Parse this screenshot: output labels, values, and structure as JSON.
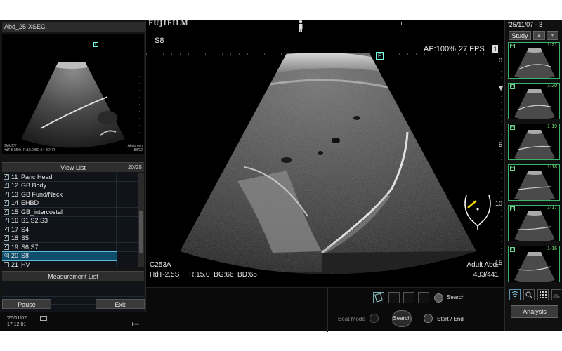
{
  "left_panel": {
    "title": "Abd_25-XSEC.",
    "thumb_meta_left": "BMk/CV\nHdT-5 MHz  R:18.0 BG:54 BD:77",
    "thumb_meta_right": "Abdomen\n88/92",
    "thumb_badge": "F",
    "view_list": {
      "title": "View List",
      "count": "20/25",
      "items": [
        {
          "check": "✓",
          "num": "11",
          "label": "Panc Head"
        },
        {
          "check": "✓",
          "num": "12",
          "label": "GB Body"
        },
        {
          "check": "✓",
          "num": "13",
          "label": "GB Fund/Neck"
        },
        {
          "check": "✓",
          "num": "14",
          "label": "EHBD"
        },
        {
          "check": "✓",
          "num": "15",
          "label": "GB_intercostal"
        },
        {
          "check": "✓",
          "num": "16",
          "label": "S1,S2,S3"
        },
        {
          "check": "✓",
          "num": "17",
          "label": "S4"
        },
        {
          "check": "✓",
          "num": "18",
          "label": "S5"
        },
        {
          "check": "✓",
          "num": "19",
          "label": "S6,S7"
        },
        {
          "check": "◎",
          "num": "20",
          "label": "S8"
        },
        {
          "check": "",
          "num": "21",
          "label": "HV"
        }
      ]
    },
    "measurement_list_title": "Measurement List",
    "pause_label": "Pause",
    "exit_label": "Exit",
    "date": "'25/11/07",
    "time": "17:12:01",
    "hdd_label": "HDD"
  },
  "center": {
    "brand": "FUJIFILM",
    "view_label": "S8",
    "f_badge": "F",
    "ap": "AP:100%",
    "fps": "27 FPS",
    "fps_box": "1",
    "depth_labels": [
      "0",
      "5",
      "10",
      "15"
    ],
    "scan_info_left": [
      "C253A",
      "HdT-2.5S     R:15.0  BG:66  BD:65"
    ],
    "scan_info_right": [
      "Adult Abd.",
      "433/441"
    ]
  },
  "bottom": {
    "search_label": "Search",
    "beat_mode_label": "Beat Mode",
    "search_btn_label": "Search",
    "start_end_label": "Start / End"
  },
  "right_panel": {
    "date": "'25/11/07 - 3",
    "study_label": "Study",
    "thumbs": [
      {
        "badge": "R",
        "label": "1-21"
      },
      {
        "badge": "R",
        "label": "1-20"
      },
      {
        "badge": "R",
        "label": "1-19"
      },
      {
        "badge": "R",
        "label": "1-18"
      },
      {
        "badge": "R",
        "label": "1-17"
      },
      {
        "badge": "R",
        "label": "1-16"
      }
    ],
    "analysis_label": "Analysis"
  }
}
